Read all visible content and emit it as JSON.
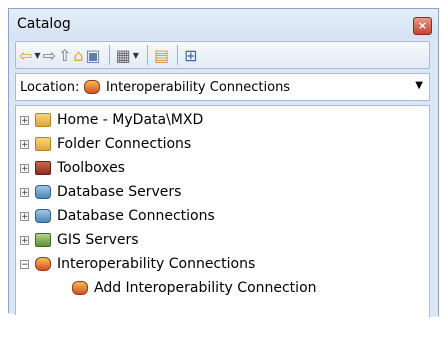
{
  "window": {
    "title": "Catalog",
    "close_glyph": "×"
  },
  "toolbar": {
    "icons": [
      "back-arrow-icon",
      "forward-arrow-icon",
      "up-folder-icon",
      "home-folder-icon",
      "folder-icon",
      "view-options-icon",
      "new-connection-icon",
      "tree-toggle-icon"
    ]
  },
  "location": {
    "label": "Location:",
    "value": "Interoperability Connections",
    "icon": "interop-icon"
  },
  "tree": {
    "items": [
      {
        "label": "Home - MyData\\MXD",
        "icon": "home-folder-icon",
        "expander": "+"
      },
      {
        "label": "Folder Connections",
        "icon": "folder-connections-icon",
        "expander": "+"
      },
      {
        "label": "Toolboxes",
        "icon": "toolbox-icon",
        "expander": "+"
      },
      {
        "label": "Database Servers",
        "icon": "database-server-icon",
        "expander": "+"
      },
      {
        "label": "Database Connections",
        "icon": "database-connection-icon",
        "expander": "+"
      },
      {
        "label": "GIS Servers",
        "icon": "gis-server-icon",
        "expander": "+"
      },
      {
        "label": "Interoperability Connections",
        "icon": "interop-icon",
        "expander": "−"
      }
    ],
    "child": {
      "label": "Add Interoperability Connection",
      "icon": "add-interop-icon"
    }
  }
}
